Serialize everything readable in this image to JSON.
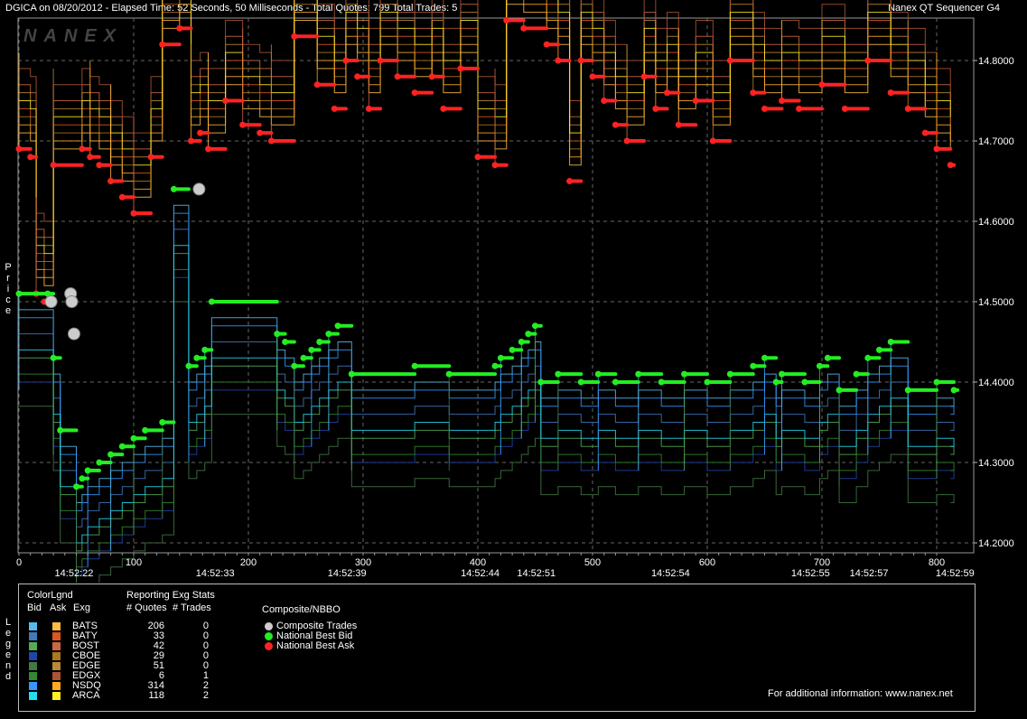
{
  "header": {
    "left": "DGICA on 08/20/2012  -  Elapsed Time: 52 Seconds, 50 Milliseconds  -  Total Quotes: 799  Total Trades: 5",
    "right": "Nanex QT Sequencer G4"
  },
  "watermark": "NANEX",
  "side_labels": {
    "price": "Price",
    "legend": "Legend"
  },
  "chart_data": {
    "type": "line",
    "title": "DGICA on 08/20/2012",
    "xlabel": "",
    "ylabel": "Price",
    "xlim": [
      0,
      812
    ],
    "ylim": [
      14.19,
      14.855
    ],
    "grid": true,
    "y_ticks": [
      "14.2000",
      "14.3000",
      "14.4000",
      "14.5000",
      "14.6000",
      "14.7000",
      "14.8000"
    ],
    "x_ticks": [
      0,
      100,
      200,
      300,
      400,
      500,
      600,
      700,
      800
    ],
    "time_labels": [
      {
        "x": 48,
        "label": "14:52:22"
      },
      {
        "x": 171,
        "label": "14:52:33"
      },
      {
        "x": 286,
        "label": "14:52:39"
      },
      {
        "x": 402,
        "label": "14:52:44"
      },
      {
        "x": 451,
        "label": "14:52:51"
      },
      {
        "x": 568,
        "label": "14:52:54"
      },
      {
        "x": 690,
        "label": "14:52:55"
      },
      {
        "x": 741,
        "label": "14:52:57"
      },
      {
        "x": 816,
        "label": "14:52:59"
      }
    ],
    "series": [
      {
        "name": "National Best Bid",
        "color": "#22ee22",
        "points": [
          [
            0,
            14.51
          ],
          [
            25,
            14.51
          ],
          [
            30,
            14.43
          ],
          [
            36,
            14.34
          ],
          [
            50,
            14.27
          ],
          [
            55,
            14.28
          ],
          [
            60,
            14.29
          ],
          [
            70,
            14.3
          ],
          [
            80,
            14.31
          ],
          [
            90,
            14.32
          ],
          [
            100,
            14.33
          ],
          [
            110,
            14.34
          ],
          [
            125,
            14.35
          ],
          [
            135,
            14.64
          ],
          [
            148,
            14.42
          ],
          [
            155,
            14.43
          ],
          [
            162,
            14.44
          ],
          [
            168,
            14.5
          ],
          [
            225,
            14.46
          ],
          [
            232,
            14.45
          ],
          [
            240,
            14.42
          ],
          [
            248,
            14.43
          ],
          [
            255,
            14.44
          ],
          [
            262,
            14.45
          ],
          [
            270,
            14.46
          ],
          [
            278,
            14.47
          ],
          [
            290,
            14.41
          ],
          [
            345,
            14.42
          ],
          [
            375,
            14.41
          ],
          [
            415,
            14.42
          ],
          [
            420,
            14.43
          ],
          [
            430,
            14.44
          ],
          [
            438,
            14.45
          ],
          [
            444,
            14.46
          ],
          [
            450,
            14.47
          ],
          [
            455,
            14.4
          ],
          [
            470,
            14.41
          ],
          [
            490,
            14.4
          ],
          [
            505,
            14.41
          ],
          [
            520,
            14.4
          ],
          [
            540,
            14.41
          ],
          [
            560,
            14.4
          ],
          [
            580,
            14.41
          ],
          [
            600,
            14.4
          ],
          [
            620,
            14.41
          ],
          [
            640,
            14.42
          ],
          [
            650,
            14.43
          ],
          [
            660,
            14.4
          ],
          [
            665,
            14.41
          ],
          [
            685,
            14.4
          ],
          [
            698,
            14.42
          ],
          [
            705,
            14.43
          ],
          [
            715,
            14.39
          ],
          [
            730,
            14.41
          ],
          [
            740,
            14.43
          ],
          [
            750,
            14.44
          ],
          [
            760,
            14.45
          ],
          [
            775,
            14.39
          ],
          [
            800,
            14.4
          ],
          [
            815,
            14.39
          ]
        ]
      },
      {
        "name": "National Best Ask",
        "color": "#ff2222",
        "points": [
          [
            0,
            14.69
          ],
          [
            10,
            14.68
          ],
          [
            15,
            14.51
          ],
          [
            22,
            14.5
          ],
          [
            30,
            14.67
          ],
          [
            55,
            14.69
          ],
          [
            62,
            14.68
          ],
          [
            70,
            14.67
          ],
          [
            80,
            14.65
          ],
          [
            90,
            14.63
          ],
          [
            100,
            14.61
          ],
          [
            115,
            14.68
          ],
          [
            125,
            14.82
          ],
          [
            140,
            14.84
          ],
          [
            150,
            14.7
          ],
          [
            158,
            14.71
          ],
          [
            165,
            14.69
          ],
          [
            180,
            14.75
          ],
          [
            195,
            14.72
          ],
          [
            210,
            14.71
          ],
          [
            220,
            14.7
          ],
          [
            240,
            14.83
          ],
          [
            260,
            14.77
          ],
          [
            275,
            14.74
          ],
          [
            285,
            14.8
          ],
          [
            295,
            14.78
          ],
          [
            305,
            14.74
          ],
          [
            315,
            14.8
          ],
          [
            330,
            14.78
          ],
          [
            345,
            14.76
          ],
          [
            360,
            14.78
          ],
          [
            370,
            14.74
          ],
          [
            385,
            14.79
          ],
          [
            400,
            14.68
          ],
          [
            415,
            14.67
          ],
          [
            425,
            14.85
          ],
          [
            440,
            14.84
          ],
          [
            460,
            14.82
          ],
          [
            470,
            14.8
          ],
          [
            480,
            14.65
          ],
          [
            490,
            14.8
          ],
          [
            500,
            14.78
          ],
          [
            510,
            14.75
          ],
          [
            520,
            14.72
          ],
          [
            530,
            14.7
          ],
          [
            545,
            14.78
          ],
          [
            555,
            14.74
          ],
          [
            565,
            14.76
          ],
          [
            575,
            14.72
          ],
          [
            590,
            14.75
          ],
          [
            605,
            14.7
          ],
          [
            620,
            14.8
          ],
          [
            640,
            14.76
          ],
          [
            650,
            14.74
          ],
          [
            665,
            14.75
          ],
          [
            680,
            14.74
          ],
          [
            700,
            14.77
          ],
          [
            720,
            14.74
          ],
          [
            740,
            14.8
          ],
          [
            760,
            14.76
          ],
          [
            775,
            14.74
          ],
          [
            790,
            14.71
          ],
          [
            800,
            14.69
          ],
          [
            812,
            14.67
          ]
        ]
      }
    ],
    "composite_trades": [
      [
        28,
        14.5
      ],
      [
        45,
        14.51
      ],
      [
        46,
        14.5
      ],
      [
        48,
        14.46
      ],
      [
        157,
        14.64
      ]
    ]
  },
  "legend": {
    "headers": {
      "color_legend": "ColorLgnd",
      "bid": "Bid",
      "ask": "Ask",
      "exg": "Exg",
      "stats": "Reporting Exg Stats",
      "quotes": "# Quotes",
      "trades": "# Trades",
      "composite": "Composite/NBBO"
    },
    "exchanges": [
      {
        "name": "BATS",
        "bid_color": "#55bbee",
        "ask_color": "#ffbb44",
        "quotes": "206",
        "trades": "0"
      },
      {
        "name": "BATY",
        "bid_color": "#4477bb",
        "ask_color": "#dd5522",
        "quotes": "33",
        "trades": "0"
      },
      {
        "name": "BOST",
        "bid_color": "#55aa55",
        "ask_color": "#cc6644",
        "quotes": "42",
        "trades": "0"
      },
      {
        "name": "CBOE",
        "bid_color": "#2244aa",
        "ask_color": "#aa7722",
        "quotes": "29",
        "trades": "0"
      },
      {
        "name": "EDGE",
        "bid_color": "#447744",
        "ask_color": "#bb8833",
        "quotes": "51",
        "trades": "0"
      },
      {
        "name": "EDGX",
        "bid_color": "#338833",
        "ask_color": "#aa5533",
        "quotes": "6",
        "trades": "1"
      },
      {
        "name": "NSDQ",
        "bid_color": "#3399ff",
        "ask_color": "#ffaa22",
        "quotes": "314",
        "trades": "2"
      },
      {
        "name": "ARCA",
        "bid_color": "#22ddee",
        "ask_color": "#ffee22",
        "quotes": "118",
        "trades": "2"
      }
    ],
    "composite_items": [
      {
        "label": "Composite Trades",
        "color": "#cccccc"
      },
      {
        "label": "National Best Bid",
        "color": "#22ee22"
      },
      {
        "label": "National Best Ask",
        "color": "#ff2222"
      }
    ],
    "footer": "For additional information: www.nanex.net"
  }
}
